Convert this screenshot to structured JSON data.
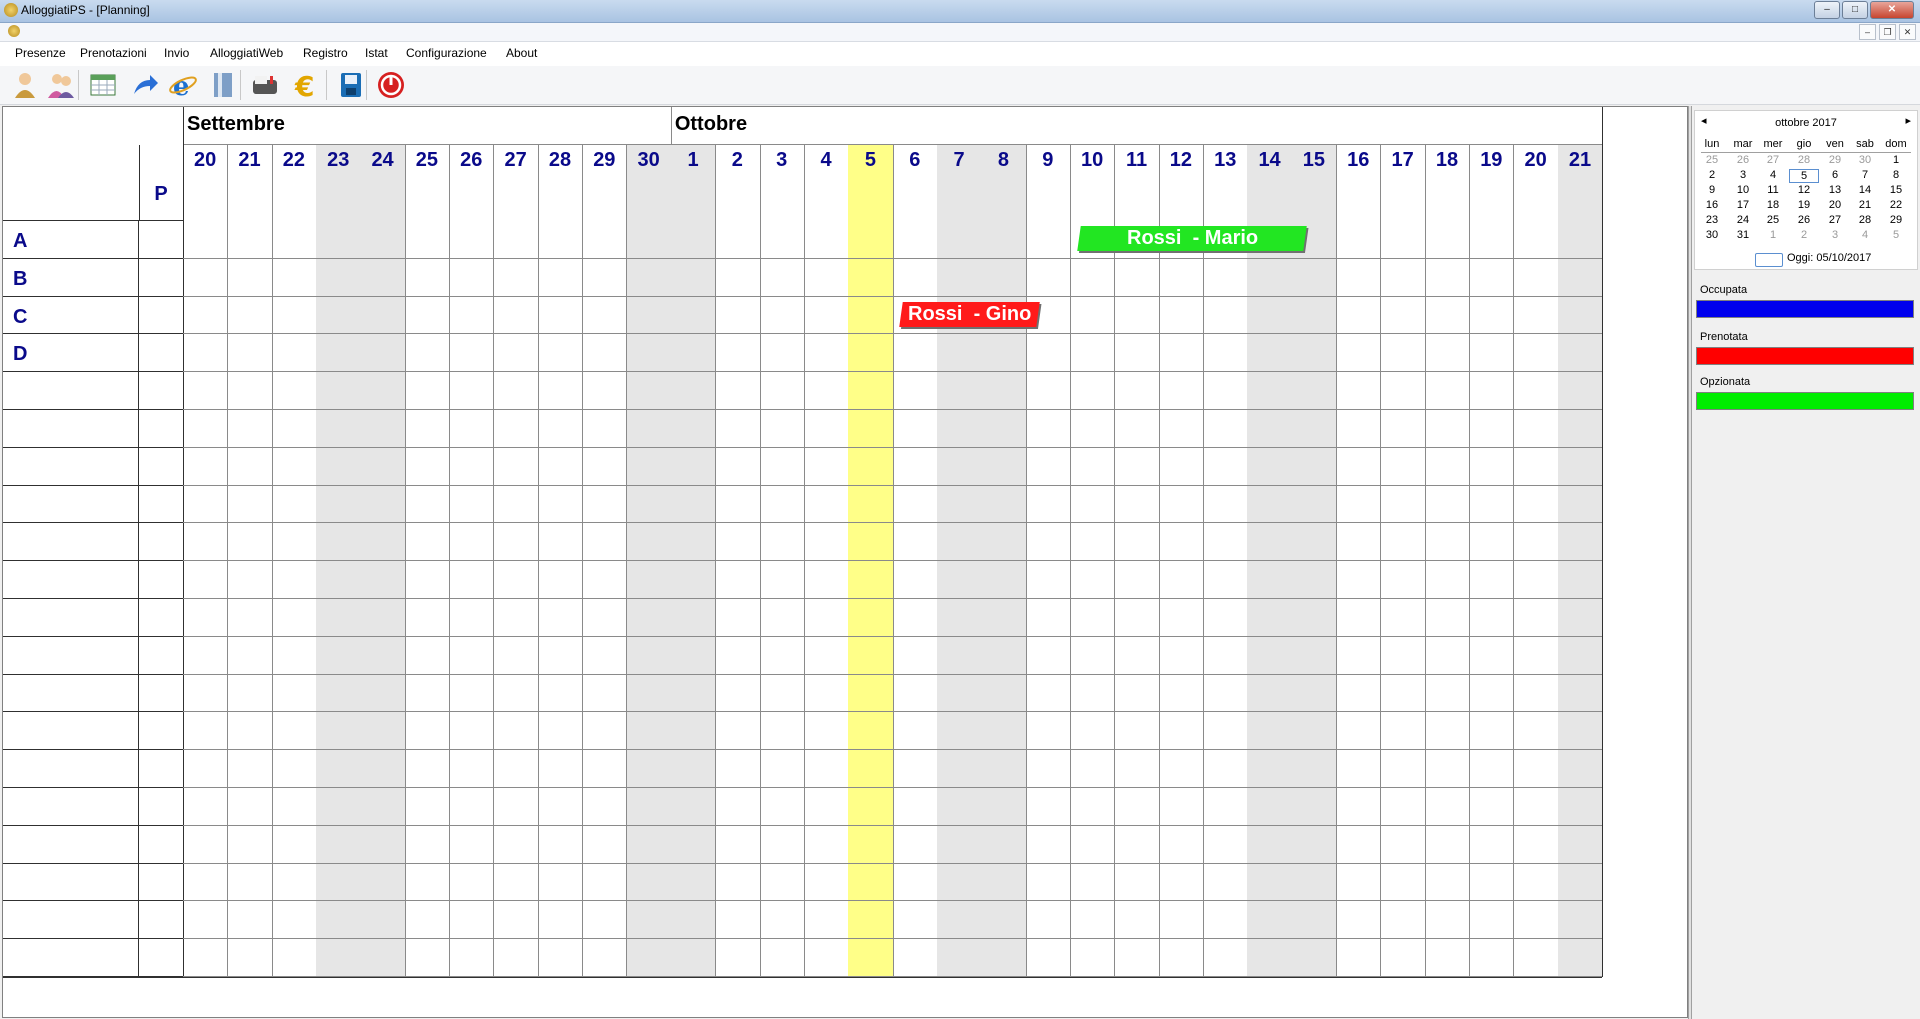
{
  "window": {
    "title": "AlloggiatiPS - [Planning]"
  },
  "menu": [
    "Presenze",
    "Prenotazioni",
    "Invio",
    "AlloggiatiWeb",
    "Registro",
    "Istat",
    "Configurazione",
    "About"
  ],
  "toolbar": [
    {
      "name": "guest-icon"
    },
    {
      "name": "guests-group-icon"
    },
    {
      "name": "spreadsheet-icon"
    },
    {
      "name": "send-arrow-icon"
    },
    {
      "name": "browser-icon"
    },
    {
      "name": "register-book-icon"
    },
    {
      "name": "mailbox-icon"
    },
    {
      "name": "euro-icon"
    },
    {
      "name": "save-disk-icon"
    },
    {
      "name": "power-icon"
    }
  ],
  "planning": {
    "people_header": "P",
    "months": [
      {
        "label": "Settembre",
        "span": 11
      },
      {
        "label": "Ottobre",
        "span": 21
      }
    ],
    "days": [
      "20",
      "21",
      "22",
      "23",
      "24",
      "25",
      "26",
      "27",
      "28",
      "29",
      "30",
      "1",
      "2",
      "3",
      "4",
      "5",
      "6",
      "7",
      "8",
      "9",
      "10",
      "11",
      "12",
      "13",
      "14",
      "15",
      "16",
      "17",
      "18",
      "19",
      "20",
      "21"
    ],
    "weekend_day_indices": [
      3,
      4,
      10,
      11,
      17,
      18,
      24,
      25,
      31
    ],
    "today_index": 15,
    "rooms": [
      "A",
      "B",
      "C",
      "D",
      "",
      "",
      "",
      "",
      "",
      "",
      "",
      "",
      "",
      "",
      "",
      "",
      "",
      "",
      "",
      ""
    ],
    "bookings": [
      {
        "label": "Rossi  - Mario",
        "room_index": 0,
        "start_index": 20,
        "end_index": 25,
        "status": "Opzionata",
        "color": "#22e622"
      },
      {
        "label": "Rossi  - Gino",
        "room_index": 2,
        "start_index": 16,
        "end_index": 19,
        "status": "Prenotata",
        "color": "#ff1a1a"
      }
    ],
    "colors": {
      "weekend": "#e6e6e6",
      "today": "#ffff88",
      "day_text": "#0a0a8a"
    }
  },
  "calendar": {
    "title": "ottobre 2017",
    "prev": "◂",
    "next": "▸",
    "day_names": [
      "lun",
      "mar",
      "mer",
      "gio",
      "ven",
      "sab",
      "dom"
    ],
    "weeks": [
      [
        {
          "d": "25",
          "dim": true
        },
        {
          "d": "26",
          "dim": true
        },
        {
          "d": "27",
          "dim": true
        },
        {
          "d": "28",
          "dim": true
        },
        {
          "d": "29",
          "dim": true
        },
        {
          "d": "30",
          "dim": true
        },
        {
          "d": "1"
        }
      ],
      [
        {
          "d": "2"
        },
        {
          "d": "3"
        },
        {
          "d": "4"
        },
        {
          "d": "5",
          "sel": true
        },
        {
          "d": "6"
        },
        {
          "d": "7"
        },
        {
          "d": "8"
        }
      ],
      [
        {
          "d": "9"
        },
        {
          "d": "10"
        },
        {
          "d": "11"
        },
        {
          "d": "12"
        },
        {
          "d": "13"
        },
        {
          "d": "14"
        },
        {
          "d": "15"
        }
      ],
      [
        {
          "d": "16"
        },
        {
          "d": "17"
        },
        {
          "d": "18"
        },
        {
          "d": "19"
        },
        {
          "d": "20"
        },
        {
          "d": "21"
        },
        {
          "d": "22"
        }
      ],
      [
        {
          "d": "23"
        },
        {
          "d": "24"
        },
        {
          "d": "25"
        },
        {
          "d": "26"
        },
        {
          "d": "27"
        },
        {
          "d": "28"
        },
        {
          "d": "29"
        }
      ],
      [
        {
          "d": "30"
        },
        {
          "d": "31"
        },
        {
          "d": "1",
          "dim": true
        },
        {
          "d": "2",
          "dim": true
        },
        {
          "d": "3",
          "dim": true
        },
        {
          "d": "4",
          "dim": true
        },
        {
          "d": "5",
          "dim": true
        }
      ]
    ],
    "today_text": "Oggi: 05/10/2017"
  },
  "legend": [
    {
      "label": "Occupata",
      "color": "#0000ee"
    },
    {
      "label": "Prenotata",
      "color": "#ff0000"
    },
    {
      "label": "Opzionata",
      "color": "#00ee00"
    }
  ]
}
